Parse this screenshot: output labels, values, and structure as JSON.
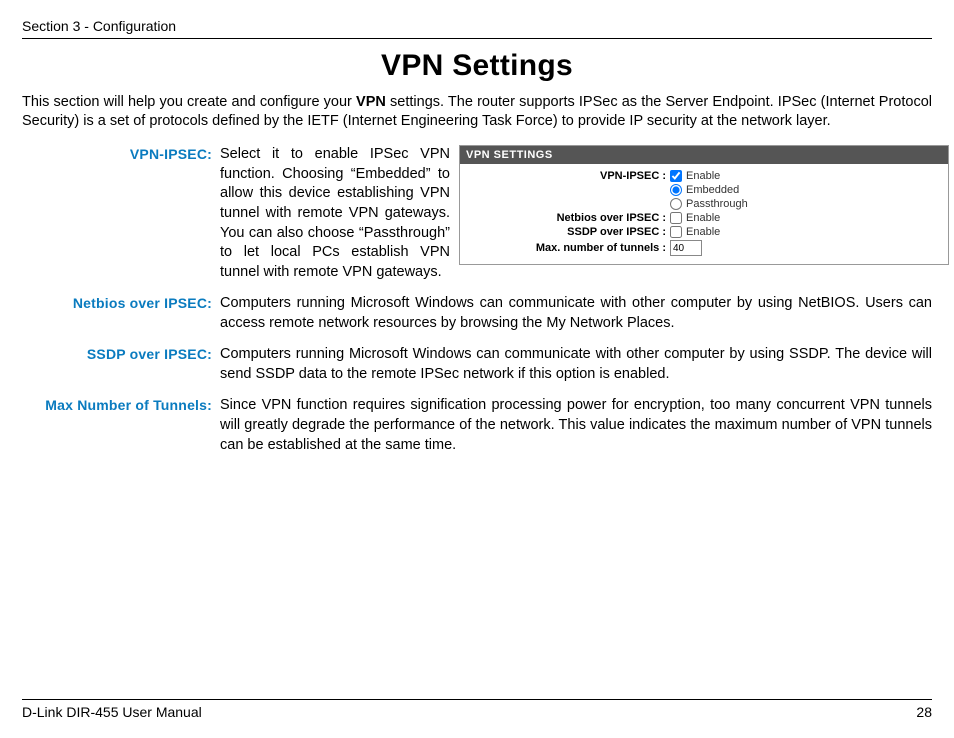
{
  "section_header": "Section 3 - Configuration",
  "title": "VPN Settings",
  "intro_pre": "This section will help you create and configure your ",
  "intro_bold": "VPN",
  "intro_post": " settings. The router supports IPSec as the Server Endpoint. IPSec (Internet Protocol Security) is a set of protocols defined by the IETF (Internet Engineering Task Force) to provide IP security at the network layer.",
  "defs": {
    "vpn_ipsec": {
      "label": "VPN-IPSEC:",
      "text": "Select it to enable IPSec VPN function. Choosing “Embedded” to allow this device establishing VPN tunnel with remote VPN gateways. You can also choose “Passthrough” to let local PCs establish VPN tunnel with remote VPN gateways."
    },
    "netbios": {
      "label": "Netbios over IPSEC:",
      "text": "Computers running Microsoft Windows can communicate with other computer by using NetBIOS. Users can access remote network resources by browsing the My Network Places."
    },
    "ssdp": {
      "label": "SSDP over IPSEC:",
      "text": "Computers running Microsoft Windows can communicate with other computer by using SSDP. The device will send SSDP data to the remote IPSec network if this option is enabled."
    },
    "maxtun": {
      "label": "Max Number of Tunnels:",
      "text": "Since VPN function requires signification processing power for encryption, too many concurrent VPN tunnels will greatly degrade the performance of the network. This value indicates the maximum number of VPN tunnels can be established at the same time."
    }
  },
  "panel": {
    "title": "VPN SETTINGS",
    "rows": {
      "vpn_ipsec_label": "VPN-IPSEC :",
      "enable": "Enable",
      "embedded": "Embedded",
      "passthrough": "Passthrough",
      "netbios_label": "Netbios over IPSEC :",
      "ssdp_label": "SSDP over IPSEC :",
      "maxtun_label": "Max. number of tunnels :",
      "maxtun_value": "40"
    }
  },
  "footer": {
    "left": "D-Link DIR-455 User Manual",
    "right": "28"
  }
}
